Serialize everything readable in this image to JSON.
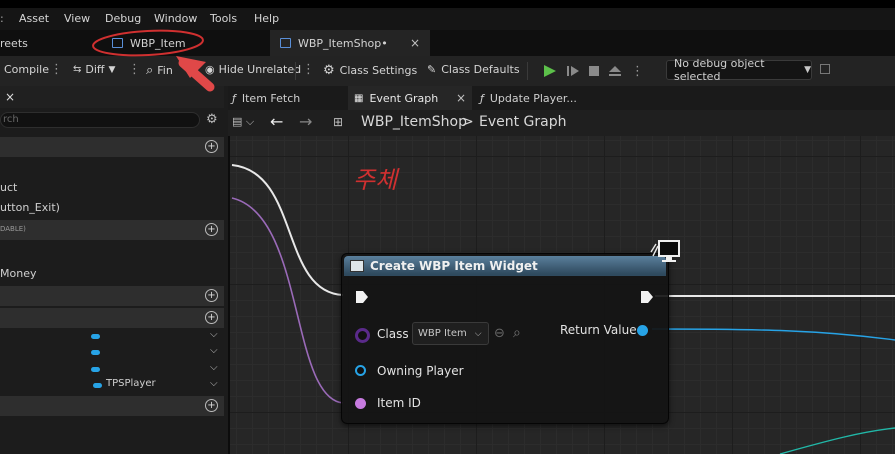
{
  "menu": [
    "Asset",
    "View",
    "Debug",
    "Window",
    "Tools",
    "Help"
  ],
  "tabs": [
    {
      "label": "reets"
    },
    {
      "label": "WBP_Item"
    },
    {
      "label": "WBP_ItemShop•",
      "close": "×"
    }
  ],
  "toolbar": {
    "compile": "Compile",
    "diff": "Diff",
    "find": "Fin",
    "hide_unrelated": "Hide Unrelated",
    "class_settings": "Class Settings",
    "class_defaults": "Class Defaults",
    "debug_object": "No debug object selected"
  },
  "left_panel": {
    "close": "×",
    "search_placeholder": "rch",
    "items": {
      "struct": "uct",
      "button_exit": "utton_Exit)",
      "section_editable": "DABLE)",
      "money": "Money",
      "tps_player": "TPSPlayer"
    }
  },
  "graph_tabs": [
    {
      "label": "Item Fetch"
    },
    {
      "label": "Event Graph",
      "close": "×"
    },
    {
      "label": "Update Player..."
    }
  ],
  "breadcrumb": {
    "root": "WBP_ItemShop",
    "separator": ">",
    "current": "Event Graph"
  },
  "annotation": {
    "text": "주체",
    "color": "#d03030"
  },
  "node": {
    "title": "Create WBP Item Widget",
    "class_label": "Class",
    "class_value": "WBP Item",
    "return_label": "Return Value",
    "owning_player_label": "Owning Player",
    "item_id_label": "Item ID"
  },
  "colors": {
    "accent_blue": "#27a3e6",
    "play_green": "#5cc04a",
    "item_id_pin": "#c77be0",
    "class_pin": "#5a2a8a",
    "annotation_red": "#d03030"
  }
}
